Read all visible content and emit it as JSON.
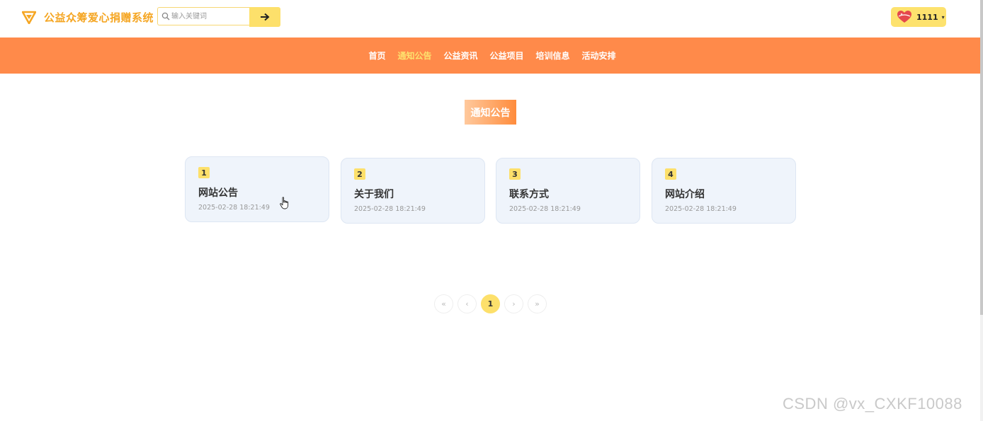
{
  "header": {
    "site_title": "公益众筹爱心捐赠系统",
    "search": {
      "placeholder": "输入关键词",
      "value": ""
    },
    "search_button_icon": "arrow-right-icon",
    "user": {
      "name": "1111",
      "caret": "▾"
    }
  },
  "nav": {
    "items": [
      {
        "label": "首页",
        "active": false
      },
      {
        "label": "通知公告",
        "active": true
      },
      {
        "label": "公益资讯",
        "active": false
      },
      {
        "label": "公益项目",
        "active": false
      },
      {
        "label": "培训信息",
        "active": false
      },
      {
        "label": "活动安排",
        "active": false
      }
    ]
  },
  "section": {
    "title": "通知公告"
  },
  "notices": [
    {
      "index": "1",
      "title": "网站公告",
      "date": "2025-02-28 18:21:49"
    },
    {
      "index": "2",
      "title": "关于我们",
      "date": "2025-02-28 18:21:49"
    },
    {
      "index": "3",
      "title": "联系方式",
      "date": "2025-02-28 18:21:49"
    },
    {
      "index": "4",
      "title": "网站介绍",
      "date": "2025-02-28 18:21:49"
    }
  ],
  "pagination": {
    "first": "«",
    "prev": "‹",
    "current": "1",
    "next": "›",
    "last": "»"
  },
  "watermark": "CSDN @vx_CXKF10088",
  "colors": {
    "brand": "#f5a623",
    "nav_bg": "#ff8a4a",
    "accent_yellow": "#fde06b",
    "card_bg": "#eff4fb"
  }
}
